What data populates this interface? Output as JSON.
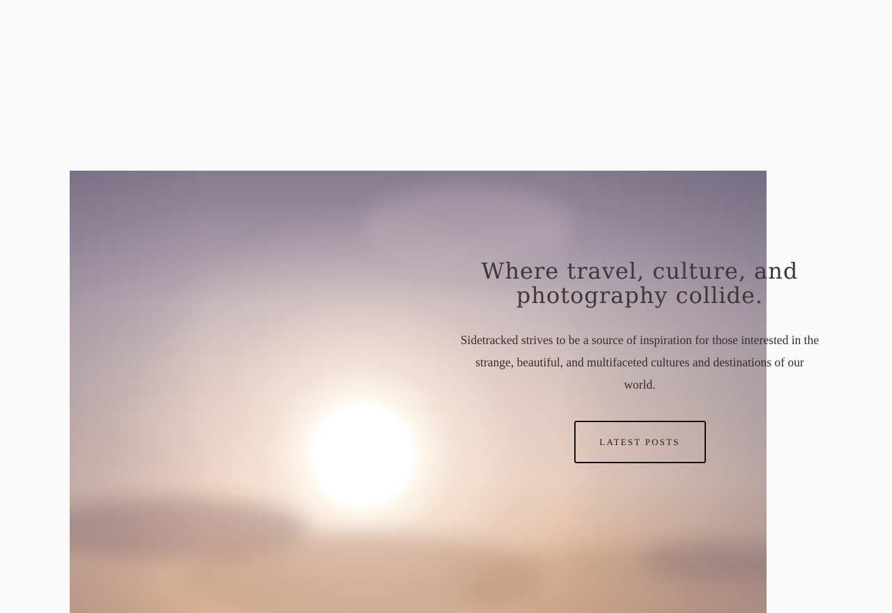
{
  "hero": {
    "title": "Where travel, culture, and photography collide.",
    "subtitle": "Sidetracked strives to be a source of inspiration for those interested in the strange, beautiful, and multifaceted cultures and destinations of our world.",
    "cta_label": "LATEST POSTS"
  },
  "colors": {
    "page_background": "#fafafa",
    "text": "#333333",
    "button_border": "#111111"
  }
}
